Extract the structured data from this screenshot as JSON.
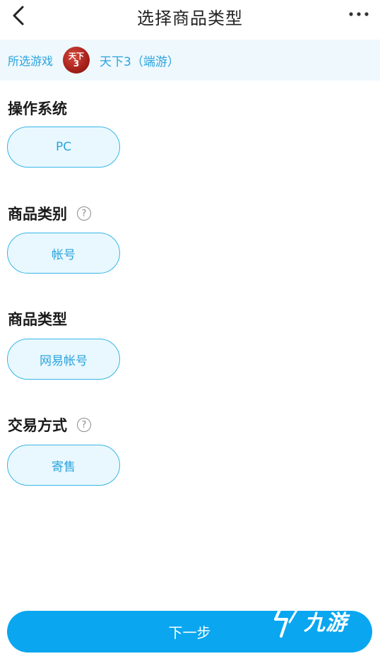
{
  "header": {
    "title": "选择商品类型",
    "back_icon": "chevron-left-icon",
    "more_icon": "more-dots-icon"
  },
  "game_bar": {
    "label": "所选游戏",
    "game_name": "天下3（端游）",
    "logo_text_top": "天下",
    "logo_text_num": "3"
  },
  "sections": {
    "os": {
      "title": "操作系统",
      "option": "PC"
    },
    "category": {
      "title": "商品类别",
      "option": "帐号"
    },
    "type": {
      "title": "商品类型",
      "option": "网易帐号"
    },
    "trade": {
      "title": "交易方式",
      "option": "寄售"
    }
  },
  "next_button": {
    "label": "下一步"
  },
  "watermark": {
    "text": "九游"
  },
  "colors": {
    "accent": "#0aa6f0",
    "option_border": "#37b6e8",
    "option_bg": "#e9f8fe",
    "option_text": "#2aa3de",
    "game_bar_bg": "#eef8fd"
  }
}
